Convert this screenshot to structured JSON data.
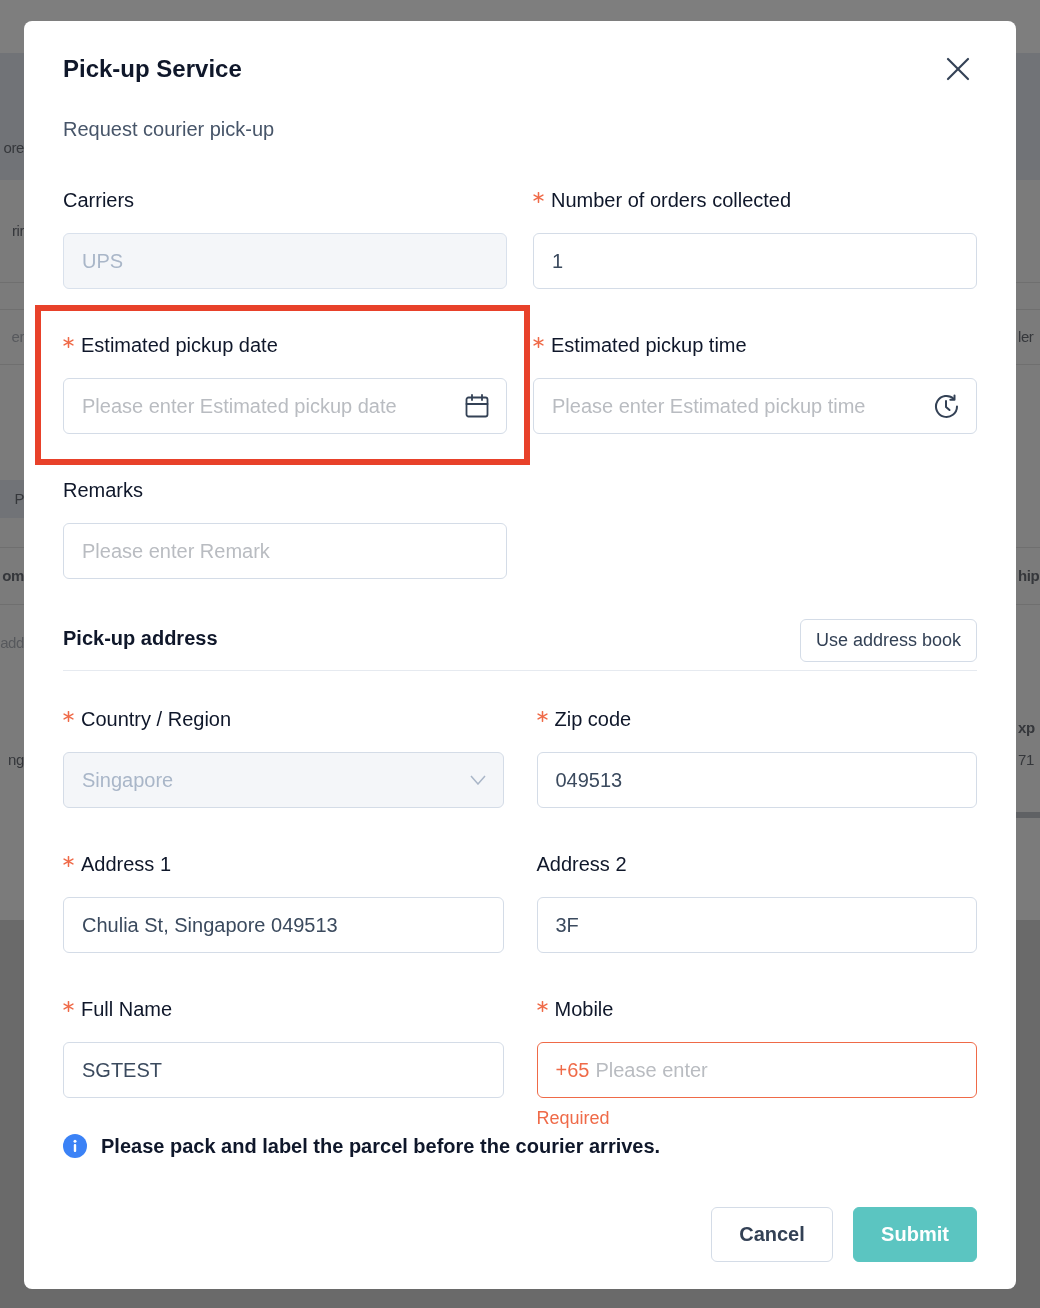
{
  "backdrop": {
    "left_fragments": [
      "ore",
      "rir",
      "er",
      "P",
      "om",
      "add",
      "ng"
    ],
    "right_fragments": [
      "ler",
      "hip",
      "xp",
      "71"
    ]
  },
  "dialog": {
    "title": "Pick-up Service",
    "subtitle": "Request courier pick-up"
  },
  "fields": [
    {
      "kind": "text",
      "label": "Carriers",
      "required": false,
      "value": "UPS",
      "disabled": true,
      "highlighted": false
    },
    {
      "kind": "text",
      "label": "Number of orders collected",
      "required": true,
      "value": "1",
      "disabled": false,
      "highlighted": false
    },
    {
      "kind": "date",
      "label": "Estimated pickup date",
      "required": true,
      "placeholder": "Please enter Estimated pickup date",
      "disabled": false,
      "highlighted": true
    },
    {
      "kind": "time",
      "label": "Estimated pickup time",
      "required": true,
      "placeholder": "Please enter Estimated pickup time",
      "disabled": false,
      "highlighted": false
    },
    {
      "kind": "text",
      "label": "Remarks",
      "required": false,
      "placeholder": "Please enter Remark",
      "disabled": false,
      "highlighted": false
    }
  ],
  "address": {
    "title": "Pick-up address",
    "address_book_button": "Use address book",
    "fields": [
      {
        "kind": "select",
        "label": "Country / Region",
        "required": true,
        "value": "Singapore",
        "disabled": true
      },
      {
        "kind": "text",
        "label": "Zip code",
        "required": true,
        "value": "049513",
        "disabled": false
      },
      {
        "kind": "text",
        "label": "Address 1",
        "required": true,
        "value": "Chulia St, Singapore 049513",
        "disabled": false
      },
      {
        "kind": "text",
        "label": "Address 2",
        "required": false,
        "value": "3F",
        "disabled": false
      },
      {
        "kind": "text",
        "label": "Full Name",
        "required": true,
        "value": "SGTEST",
        "disabled": false
      },
      {
        "kind": "phone",
        "label": "Mobile",
        "required": true,
        "prefix": "+65",
        "placeholder": "Please enter",
        "disabled": false,
        "error": "Required"
      }
    ]
  },
  "notice": "Please pack and label the parcel before the courier arrives.",
  "buttons": [
    {
      "label": "Cancel",
      "kind": "secondary"
    },
    {
      "label": "Submit",
      "kind": "primary"
    }
  ]
}
